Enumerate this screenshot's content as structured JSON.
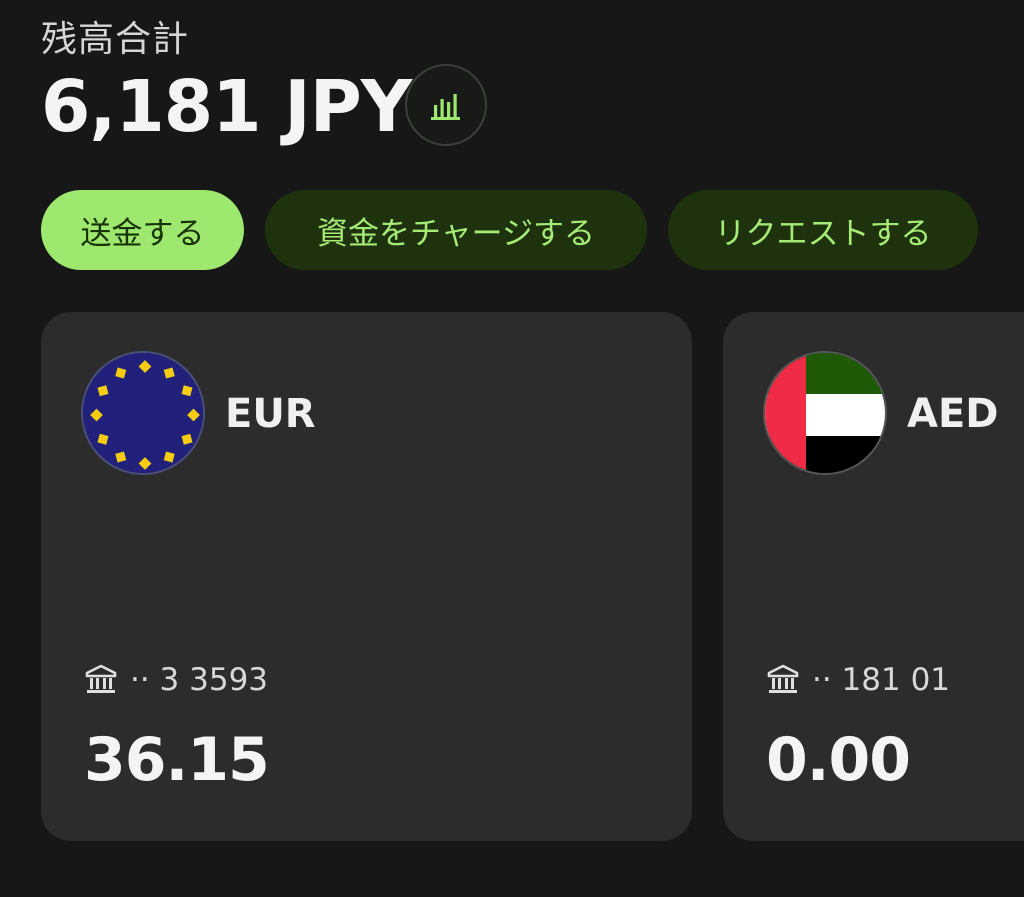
{
  "header": {
    "total_label": "残高合計",
    "total_amount": "6,181 JPY",
    "chart_icon": "bar-chart-icon"
  },
  "actions": {
    "send_label": "送金する",
    "add_money_label": "資金をチャージする",
    "request_label": "リクエストする"
  },
  "accounts": [
    {
      "flag_icon": "eu-flag-icon",
      "currency": "EUR",
      "account_mask": "·· 3 3593",
      "balance": "36.15"
    },
    {
      "flag_icon": "uae-flag-icon",
      "currency": "AED",
      "account_mask": "·· 181 01",
      "balance": "0.00"
    }
  ],
  "colors": {
    "background": "#161716",
    "card": "#2b2c2b",
    "primary_button": "#9fe870",
    "primary_text": "#163300",
    "secondary_button": "#1e330d",
    "secondary_text": "#a5eb76"
  }
}
